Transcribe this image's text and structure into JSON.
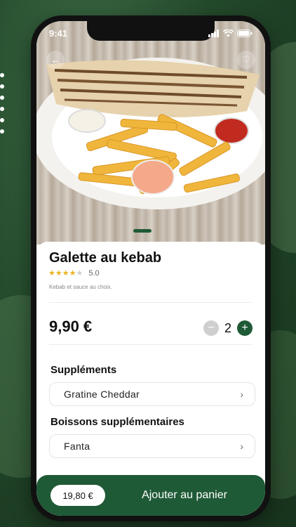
{
  "status_bar": {
    "time": "9:41"
  },
  "product": {
    "name": "Galette au kebab",
    "rating": "5.0",
    "rating_stars": 4,
    "description": "Kebab et sauce au choix.",
    "price": "9,90 €",
    "quantity": "2"
  },
  "options": [
    {
      "label": "Suppléments",
      "value": "Gratine Cheddar"
    },
    {
      "label": "Boissons supplémentaires",
      "value": "Fanta"
    }
  ],
  "cart": {
    "total": "19,80 €",
    "add_label": "Ajouter au panier"
  },
  "colors": {
    "brand_green": "#1f5a36",
    "star": "#e9b324"
  },
  "icons": {
    "back": "arrow-left-icon",
    "favorite": "heart-icon",
    "minus": "minus-icon",
    "plus": "plus-icon",
    "chevron": "chevron-right-icon"
  }
}
